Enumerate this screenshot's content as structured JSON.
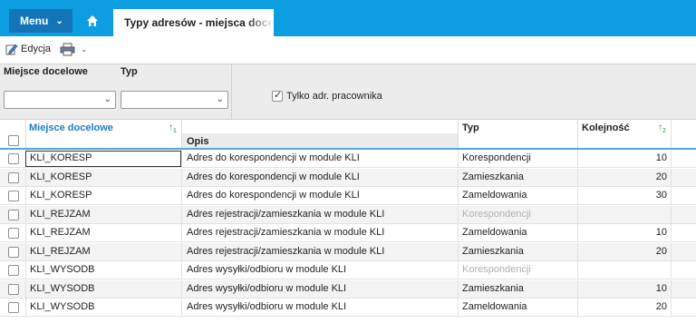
{
  "topbar": {
    "menu_label": "Menu",
    "tab_title": "Typy adresów - miejsca docelowe"
  },
  "toolbar": {
    "edit_label": "Edycja"
  },
  "filters": {
    "miejsce_label": "Miejsce docelowe",
    "miejsce_value": "",
    "typ_label": "Typ",
    "typ_value": "",
    "tylko_label": "Tylko adr. pracownika",
    "tylko_checked": true
  },
  "grid": {
    "columns": {
      "miejsce": "Miejsce docelowe",
      "opis": "Opis",
      "typ": "Typ",
      "kolejnosc": "Kolejność"
    },
    "sort_miejsce_index": "1",
    "sort_kolejnosc_index": "2",
    "rows": [
      {
        "miejsce": "KLI_KORESP",
        "opis": "Adres do korespondencji w module KLI",
        "typ": "Korespondencji",
        "kolejnosc": "10",
        "typ_disabled": false
      },
      {
        "miejsce": "KLI_KORESP",
        "opis": "Adres do korespondencji w module KLI",
        "typ": "Zamieszkania",
        "kolejnosc": "20",
        "typ_disabled": false
      },
      {
        "miejsce": "KLI_KORESP",
        "opis": "Adres do korespondencji w module KLI",
        "typ": "Zameldowania",
        "kolejnosc": "30",
        "typ_disabled": false
      },
      {
        "miejsce": "KLI_REJZAM",
        "opis": "Adres rejestracji/zamieszkania w module KLI",
        "typ": "Korespondencji",
        "kolejnosc": "",
        "typ_disabled": true
      },
      {
        "miejsce": "KLI_REJZAM",
        "opis": "Adres rejestracji/zamieszkania w module KLI",
        "typ": "Zameldowania",
        "kolejnosc": "10",
        "typ_disabled": false
      },
      {
        "miejsce": "KLI_REJZAM",
        "opis": "Adres rejestracji/zamieszkania w module KLI",
        "typ": "Zamieszkania",
        "kolejnosc": "20",
        "typ_disabled": false
      },
      {
        "miejsce": "KLI_WYSODB",
        "opis": "Adres wysyłki/odbioru w module KLI",
        "typ": "Korespondencji",
        "kolejnosc": "",
        "typ_disabled": true
      },
      {
        "miejsce": "KLI_WYSODB",
        "opis": "Adres wysyłki/odbioru w module KLI",
        "typ": "Zamieszkania",
        "kolejnosc": "10",
        "typ_disabled": false
      },
      {
        "miejsce": "KLI_WYSODB",
        "opis": "Adres wysyłki/odbioru w module KLI",
        "typ": "Zameldowania",
        "kolejnosc": "20",
        "typ_disabled": false
      }
    ]
  }
}
